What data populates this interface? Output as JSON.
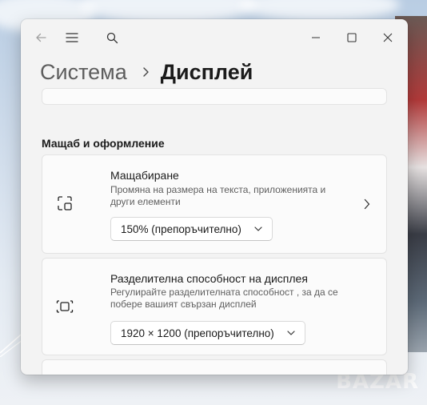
{
  "window": {
    "back_icon": "back-arrow-icon",
    "menu_icon": "hamburger-menu-icon",
    "search_icon": "search-icon",
    "minimize_icon": "minimize-icon",
    "maximize_icon": "maximize-icon",
    "close_icon": "close-icon"
  },
  "breadcrumb": {
    "parent": "Система",
    "current": "Дисплей"
  },
  "section": {
    "title": "Мащаб и оформление"
  },
  "scale": {
    "icon": "scale-icon",
    "title": "Мащабиране",
    "description": "Промяна на размера на текста, приложенията и други елементи",
    "dropdown_value": "150% (препоръчително)"
  },
  "resolution": {
    "icon": "resolution-icon",
    "title": "Разделителна способност на дисплея",
    "description": "Регулирайте разделителната способност , за да се побере вашият свързан дисплей",
    "dropdown_value": "1920 × 1200 (препоръчително)"
  },
  "watermark": "BAZAR"
}
